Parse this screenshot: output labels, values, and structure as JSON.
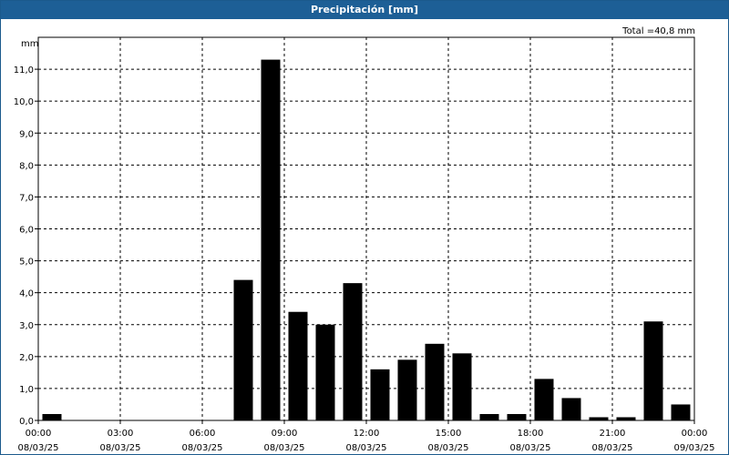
{
  "window": {
    "title": "Precipitación [mm]"
  },
  "chart_data": {
    "type": "bar",
    "title": "Precipitación [mm]",
    "ylabel": "mm",
    "total_label": "Total =40,8 mm",
    "ylim": [
      0,
      12
    ],
    "y_ticks": [
      "0,0",
      "1,0",
      "2,0",
      "3,0",
      "4,0",
      "5,0",
      "6,0",
      "7,0",
      "8,0",
      "9,0",
      "10,0",
      "11,0"
    ],
    "x_range_hours": [
      0,
      24
    ],
    "x_ticks": [
      {
        "hour": 0,
        "time": "00:00",
        "date": "08/03/25"
      },
      {
        "hour": 3,
        "time": "03:00",
        "date": "08/03/25"
      },
      {
        "hour": 6,
        "time": "06:00",
        "date": "08/03/25"
      },
      {
        "hour": 9,
        "time": "09:00",
        "date": "08/03/25"
      },
      {
        "hour": 12,
        "time": "12:00",
        "date": "08/03/25"
      },
      {
        "hour": 15,
        "time": "15:00",
        "date": "08/03/25"
      },
      {
        "hour": 18,
        "time": "18:00",
        "date": "08/03/25"
      },
      {
        "hour": 21,
        "time": "21:00",
        "date": "08/03/25"
      },
      {
        "hour": 24,
        "time": "00:00",
        "date": "09/03/25"
      }
    ],
    "grid": true,
    "bar_color": "#000000",
    "bars": [
      {
        "hour": 1,
        "value": 0.2
      },
      {
        "hour": 2,
        "value": 0.0
      },
      {
        "hour": 3,
        "value": 0.0
      },
      {
        "hour": 4,
        "value": 0.0
      },
      {
        "hour": 5,
        "value": 0.0
      },
      {
        "hour": 6,
        "value": 0.0
      },
      {
        "hour": 7,
        "value": 0.0
      },
      {
        "hour": 8,
        "value": 4.4
      },
      {
        "hour": 9,
        "value": 11.3
      },
      {
        "hour": 10,
        "value": 3.4
      },
      {
        "hour": 11,
        "value": 3.0
      },
      {
        "hour": 12,
        "value": 4.3
      },
      {
        "hour": 13,
        "value": 1.6
      },
      {
        "hour": 14,
        "value": 1.9
      },
      {
        "hour": 15,
        "value": 2.4
      },
      {
        "hour": 16,
        "value": 2.1
      },
      {
        "hour": 17,
        "value": 0.2
      },
      {
        "hour": 18,
        "value": 0.2
      },
      {
        "hour": 19,
        "value": 1.3
      },
      {
        "hour": 20,
        "value": 0.7
      },
      {
        "hour": 21,
        "value": 0.1
      },
      {
        "hour": 22,
        "value": 0.1
      },
      {
        "hour": 23,
        "value": 3.1
      },
      {
        "hour": 24,
        "value": 0.5
      }
    ]
  }
}
